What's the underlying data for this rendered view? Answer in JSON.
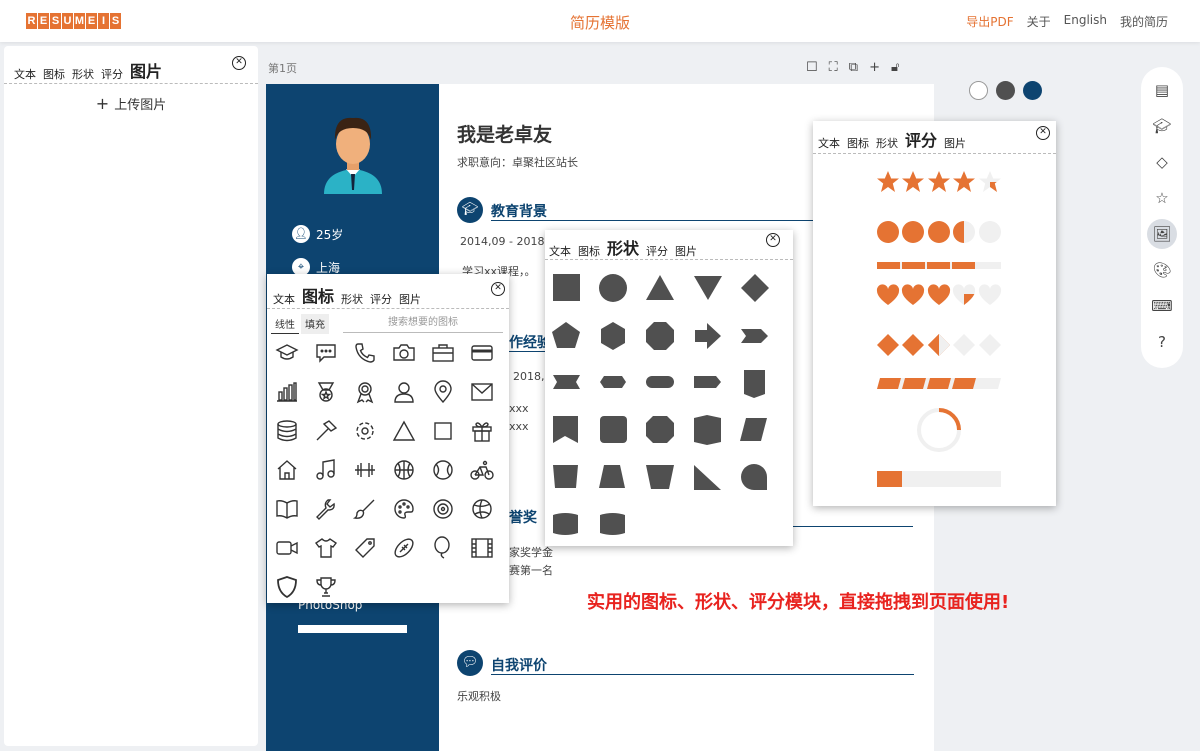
{
  "header": {
    "logo_letters": [
      "R",
      "E",
      "S",
      "U",
      "M",
      "E",
      "I",
      "S"
    ],
    "title": "简历模版",
    "nav": [
      "导出PDF",
      "关于",
      "English",
      "我的简历"
    ]
  },
  "left_panel": {
    "tabs": [
      "文本",
      "图标",
      "形状",
      "评分"
    ],
    "active_tab": "图片",
    "upload": "上传图片"
  },
  "canvas": {
    "page_label": "第1页"
  },
  "resume": {
    "name": "我是老卓友",
    "objective": "求职意向：卓聚社区站长",
    "age": "25岁",
    "city": "上海",
    "edu_title": "教育背景",
    "edu_date": "2014,09 - 2018",
    "edu_desc": "学习xx课程，。",
    "work_title": "作经验",
    "work_date": "2018,",
    "work_line1": "xxx",
    "work_line2": "xxx",
    "award_title": "誉奖",
    "award1": "家奖学金",
    "award2": "赛第一名",
    "skill": "PhotoShop",
    "self_title": "自我评价",
    "self_text": "乐观积极"
  },
  "icon_panel": {
    "tabs": [
      "文本",
      "形状",
      "评分",
      "图片"
    ],
    "active_tab": "图标",
    "subtabs": [
      "线性",
      "填充"
    ],
    "search_placeholder": "搜索想要的图标",
    "icons": [
      "graduation-cap",
      "chat",
      "phone",
      "camera",
      "briefcase",
      "card",
      "bar-chart",
      "medal",
      "award",
      "user",
      "location",
      "mail",
      "database",
      "hammer",
      "gear",
      "triangle",
      "square",
      "gift",
      "home",
      "music",
      "dumbbell",
      "basketball",
      "baseball",
      "bicycle",
      "book",
      "wrench",
      "brush",
      "palette",
      "target",
      "volleyball",
      "video",
      "tshirt",
      "tag",
      "football",
      "balloon",
      "film",
      "shield",
      "trophy"
    ]
  },
  "shape_panel": {
    "tabs": [
      "文本",
      "图标",
      "评分",
      "图片"
    ],
    "active_tab": "形状"
  },
  "rating_panel": {
    "tabs": [
      "文本",
      "图标",
      "形状",
      "图片"
    ],
    "active_tab": "评分",
    "rating_value": 4.5,
    "rating_max": 5,
    "bar_segments_filled": 4.4,
    "progress_fraction": 0.2
  },
  "promo": "实用的图标、形状、评分模块，直接拖拽到页面使用!",
  "colors": {
    "accent": "#e57333",
    "navy": "#0d4470",
    "shape": "#505050",
    "swatches": [
      "#ffffff",
      "#505050",
      "#0d4470"
    ]
  },
  "right_toolbar": {
    "help": "?"
  }
}
